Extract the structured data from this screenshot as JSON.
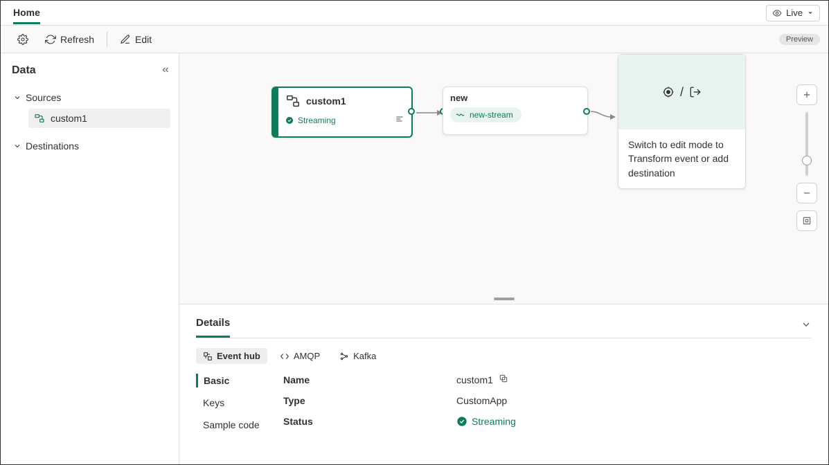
{
  "topTabs": {
    "home": "Home"
  },
  "live": {
    "label": "Live"
  },
  "toolbar": {
    "refresh": "Refresh",
    "edit": "Edit",
    "preview_badge": "Preview"
  },
  "sidebar": {
    "title": "Data",
    "sources_label": "Sources",
    "destinations_label": "Destinations",
    "sources": [
      {
        "label": "custom1"
      }
    ]
  },
  "canvas": {
    "node_custom": {
      "title": "custom1",
      "status": "Streaming"
    },
    "node_stream": {
      "title": "new",
      "chip": "new-stream"
    },
    "node_dest": {
      "message": "Switch to edit mode to Transform event or add destination",
      "slash": "/"
    }
  },
  "details": {
    "title": "Details",
    "protocol_tabs": {
      "event_hub": "Event hub",
      "amqp": "AMQP",
      "kafka": "Kafka"
    },
    "side_tabs": {
      "basic": "Basic",
      "keys": "Keys",
      "sample_code": "Sample code"
    },
    "labels": {
      "name": "Name",
      "type": "Type",
      "status": "Status"
    },
    "values": {
      "name": "custom1",
      "type": "CustomApp",
      "status": "Streaming"
    }
  }
}
